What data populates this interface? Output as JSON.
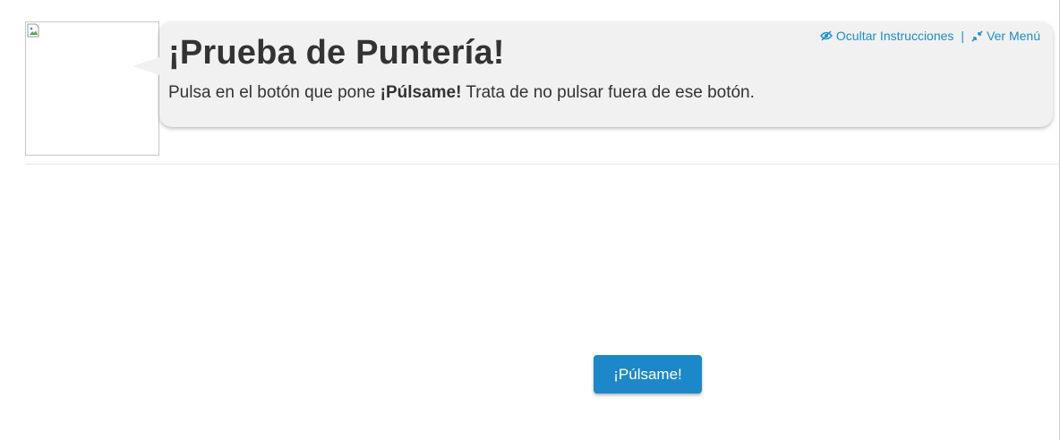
{
  "header": {
    "title": "¡Prueba de Puntería!",
    "instructions_before": "Pulsa en el botón que pone ",
    "instructions_bold": "¡Púlsame!",
    "instructions_after": " Trata de no pulsar fuera de ese botón."
  },
  "links": {
    "hide_instructions": "Ocultar Instrucciones",
    "separator": "|",
    "show_menu": "Ver Menú",
    "hide_icon": "eye-slash-icon",
    "menu_icon": "compress-arrows-icon"
  },
  "main": {
    "button_label": "¡Púlsame!"
  },
  "colors": {
    "accent": "#1a8fd0",
    "button": "#1d88c9",
    "bubble": "#f1f1f1"
  }
}
